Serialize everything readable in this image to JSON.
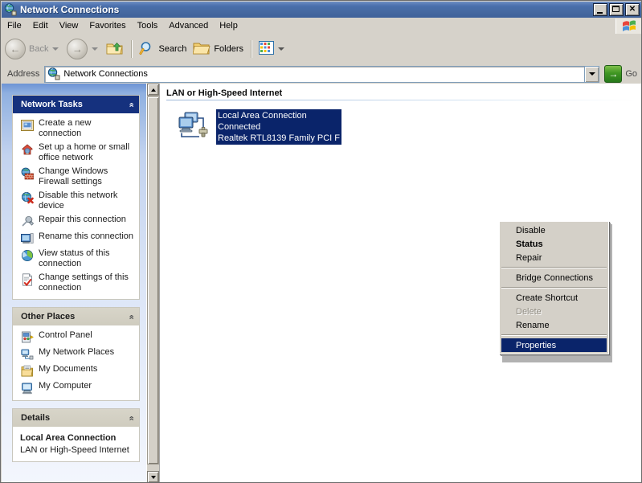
{
  "window": {
    "title": "Network Connections",
    "title_icon": "network-globe-icon",
    "buttons": {
      "minimize": "_",
      "maximize": "□",
      "close": "×"
    }
  },
  "menubar": {
    "items": [
      {
        "label": "File"
      },
      {
        "label": "Edit"
      },
      {
        "label": "View"
      },
      {
        "label": "Favorites"
      },
      {
        "label": "Tools"
      },
      {
        "label": "Advanced"
      },
      {
        "label": "Help"
      }
    ],
    "brand_icon": "windows-flag-icon"
  },
  "toolbar": {
    "back_label": "Back",
    "forward_label": "",
    "up_label": "",
    "search_label": "Search",
    "folders_label": "Folders",
    "views_label": ""
  },
  "address": {
    "label": "Address",
    "value": "Network Connections",
    "icon": "network-globe-icon",
    "go_label": "Go",
    "go_glyph": "→"
  },
  "sidebar": {
    "panels": [
      {
        "title": "Network Tasks",
        "style": "blue",
        "collapse_glyph": "«",
        "items": [
          {
            "label": "Create a new connection",
            "icon": "new-connection-icon"
          },
          {
            "label": "Set up a home or small office network",
            "icon": "home-network-icon"
          },
          {
            "label": "Change Windows Firewall settings",
            "icon": "firewall-icon"
          },
          {
            "label": "Disable this network device",
            "icon": "disable-device-icon"
          },
          {
            "label": "Repair this connection",
            "icon": "repair-wrench-icon"
          },
          {
            "label": "Rename this connection",
            "icon": "rename-icon"
          },
          {
            "label": "View status of this connection",
            "icon": "status-icon"
          },
          {
            "label": "Change settings of this connection",
            "icon": "settings-icon"
          }
        ]
      },
      {
        "title": "Other Places",
        "style": "tan",
        "collapse_glyph": "«",
        "items": [
          {
            "label": "Control Panel",
            "icon": "control-panel-icon"
          },
          {
            "label": "My Network Places",
            "icon": "my-network-places-icon"
          },
          {
            "label": "My Documents",
            "icon": "my-documents-icon"
          },
          {
            "label": "My Computer",
            "icon": "my-computer-icon"
          }
        ]
      },
      {
        "title": "Details",
        "style": "tan",
        "collapse_glyph": "«",
        "detail_title": "Local Area Connection",
        "detail_subtitle": "LAN or High-Speed Internet"
      }
    ]
  },
  "content": {
    "group_header": "LAN or High-Speed Internet",
    "connection": {
      "icon": "lan-connection-icon",
      "name": "Local Area Connection",
      "status": "Connected",
      "adapter": "Realtek RTL8139 Family PCI F"
    }
  },
  "context_menu": {
    "items": [
      {
        "label": "Disable",
        "state": "normal"
      },
      {
        "label": "Status",
        "state": "bold"
      },
      {
        "label": "Repair",
        "state": "normal"
      },
      {
        "label": "",
        "state": "separator"
      },
      {
        "label": "Bridge Connections",
        "state": "normal"
      },
      {
        "label": "",
        "state": "separator"
      },
      {
        "label": "Create Shortcut",
        "state": "normal"
      },
      {
        "label": "Delete",
        "state": "disabled"
      },
      {
        "label": "Rename",
        "state": "normal"
      },
      {
        "label": "",
        "state": "separator"
      },
      {
        "label": "Properties",
        "state": "selected"
      }
    ]
  },
  "colors": {
    "titlebar": "#4a6fab",
    "panel_header_blue": "#15317e",
    "panel_header_tan": "#d4d0c4",
    "selection": "#0a246a",
    "chrome": "#d4d0c8",
    "go_green": "#3f9622"
  }
}
